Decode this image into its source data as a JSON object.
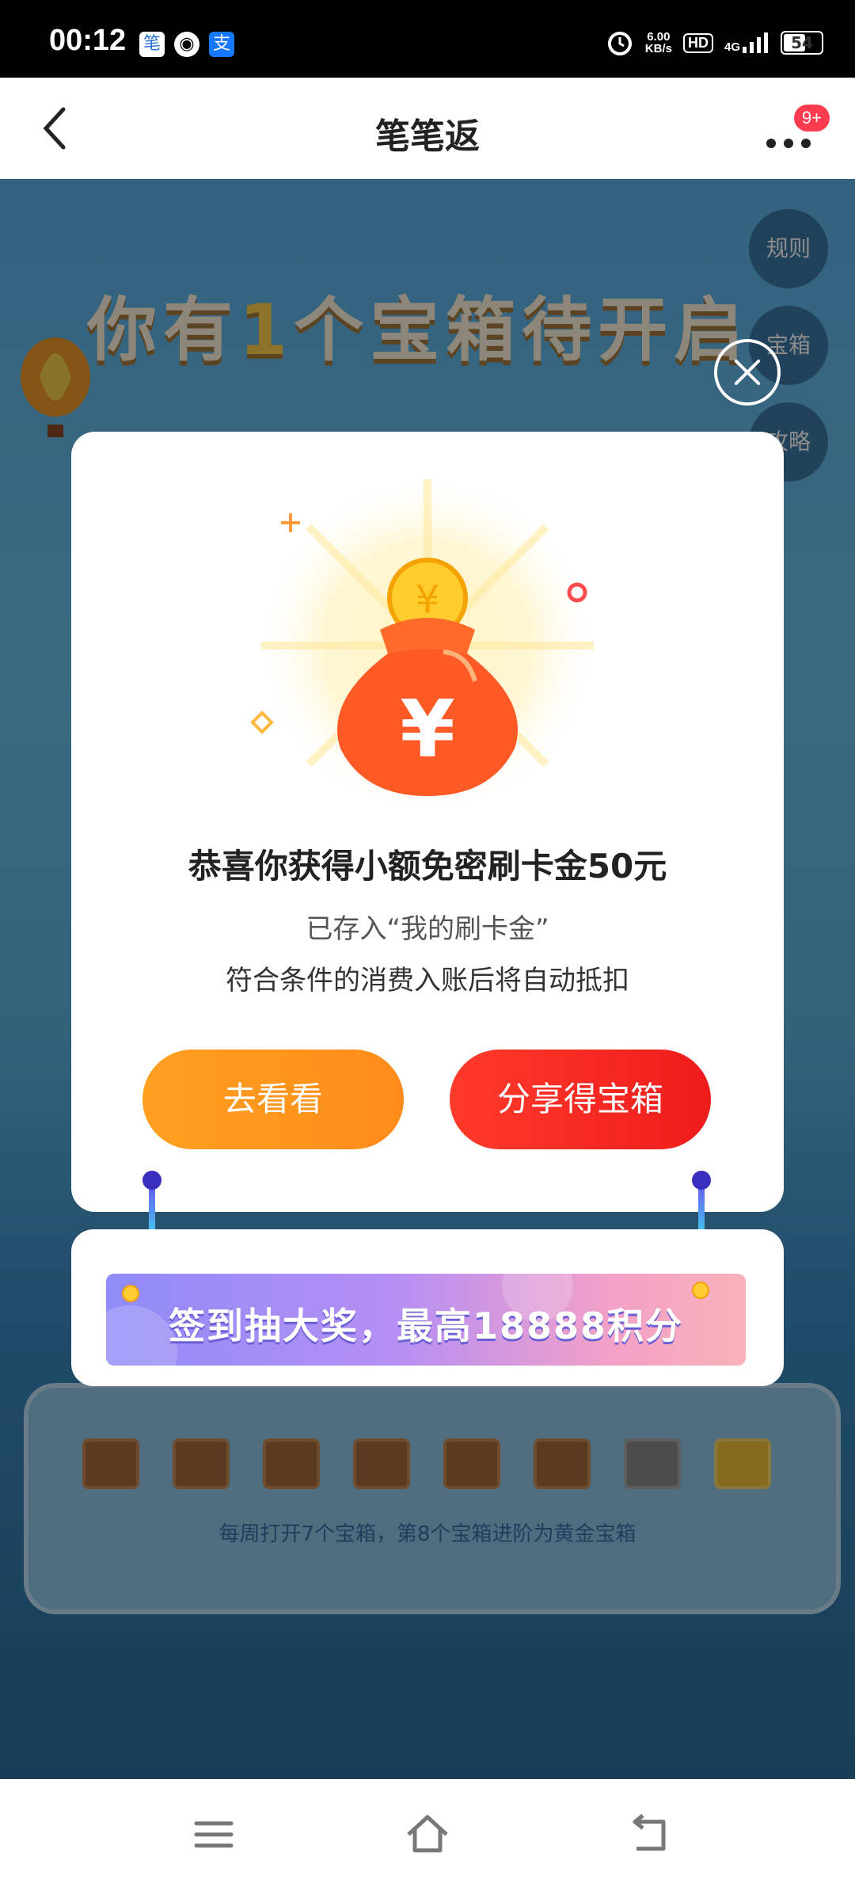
{
  "status_bar": {
    "time": "00:12",
    "speed_value": "6.00",
    "speed_unit": "KB/s",
    "hd_label": "HD",
    "network": "4G",
    "battery": "54",
    "icons": [
      "app-icon-1",
      "cat-icon",
      "alipay-icon",
      "alarm-icon",
      "signal-icon",
      "battery-icon"
    ]
  },
  "nav": {
    "title": "笔笔返",
    "badge": "9+"
  },
  "background": {
    "headline_pre": "你有",
    "headline_count": "1",
    "headline_post": "个宝箱待开启",
    "side_buttons": [
      "规则",
      "宝箱",
      "攻略"
    ],
    "tray_hint": "每周打开7个宝箱，第8个宝箱进阶为黄金宝箱",
    "box_count": 8
  },
  "modal": {
    "title": "恭喜你获得小额免密刷卡金50元",
    "subtitle1": "已存入“我的刷卡金”",
    "subtitle2": "符合条件的消费入账后将自动抵扣",
    "button_look": "去看看",
    "button_share": "分享得宝箱",
    "banner_text": "签到抽大奖，最高18888积分"
  },
  "colors": {
    "accent_orange": "#ff9a1f",
    "accent_red": "#f0201c",
    "banner_purple": "#a98ff5"
  }
}
